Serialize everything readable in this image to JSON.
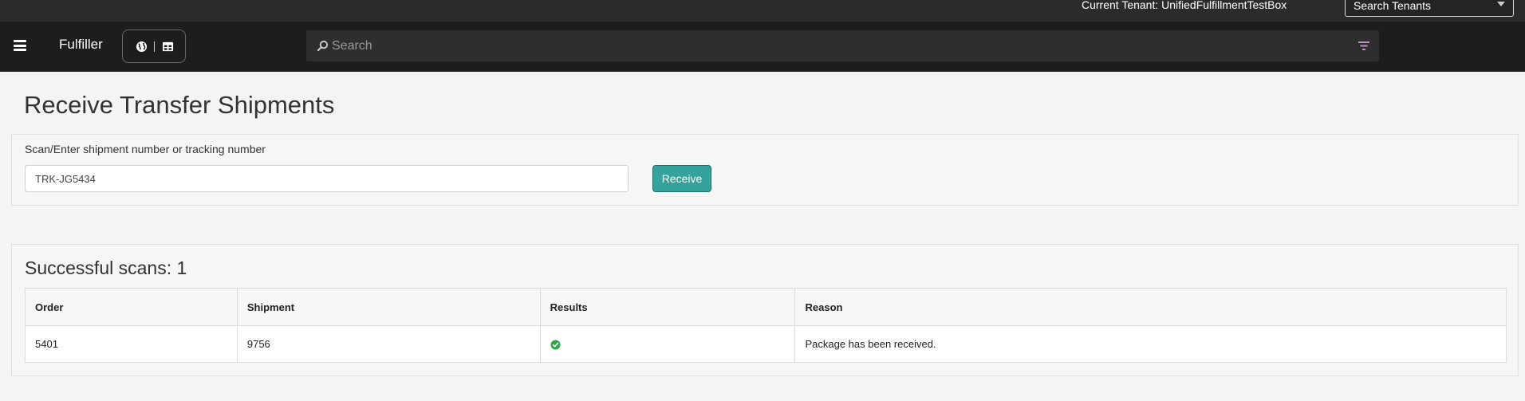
{
  "topbar": {
    "tenant_label": "Current Tenant: UnifiedFulfillmentTestBox",
    "tenant_select": "Search Tenants"
  },
  "navbar": {
    "brand": "Fulfiller",
    "search_placeholder": "Search"
  },
  "page": {
    "title": "Receive Transfer Shipments"
  },
  "receive_form": {
    "label": "Scan/Enter shipment number or tracking number",
    "value": "TRK-JG5434",
    "button_label": "Receive"
  },
  "results": {
    "title": "Successful scans: 1",
    "columns": [
      "Order",
      "Shipment",
      "Results",
      "Reason"
    ],
    "rows": [
      {
        "order": "5401",
        "shipment": "9756",
        "result_icon": "check-circle-icon",
        "reason": "Package has been received."
      }
    ]
  },
  "colors": {
    "topbar": "#2b2b2b",
    "navbar": "#1d1d1d",
    "accent": "#33a39b",
    "success": "#28a745"
  }
}
